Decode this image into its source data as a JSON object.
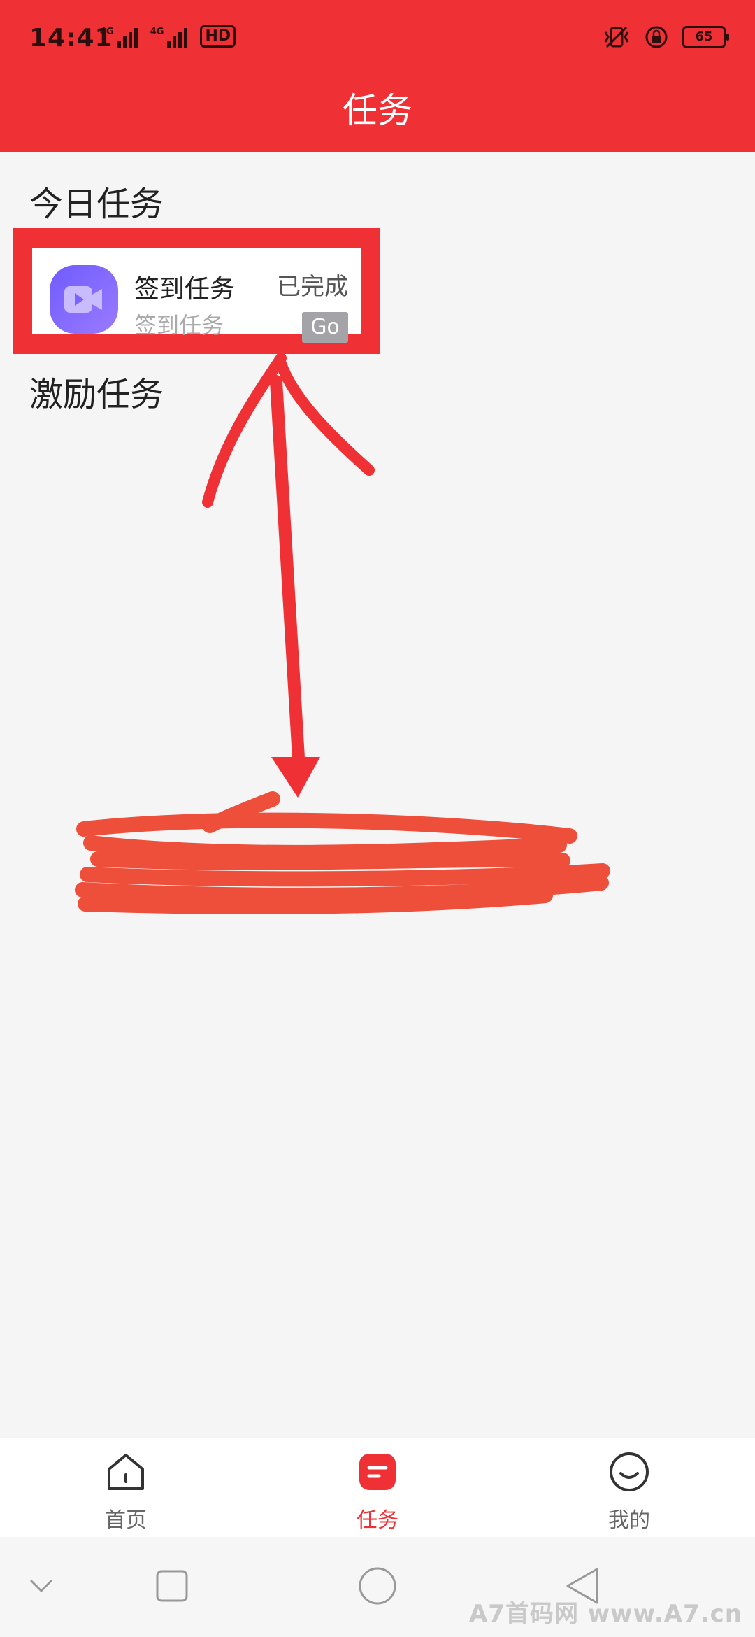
{
  "status_bar": {
    "time": "14:41",
    "signal_labels": [
      "4G",
      "4G"
    ],
    "hd_label": "HD",
    "battery": "65",
    "icons": [
      "vibrate-icon",
      "rotation-lock-icon",
      "battery-icon"
    ]
  },
  "header": {
    "title": "任务",
    "background": "#ef3136"
  },
  "sections": {
    "today_title": "今日任务",
    "incentive_title": "激励任务"
  },
  "task_card": {
    "name": "签到任务",
    "subtitle": "签到任务",
    "status": "已完成",
    "go_label": "Go",
    "icon": "video-play-icon"
  },
  "tabbar": {
    "items": [
      {
        "label": "首页",
        "icon": "home-icon",
        "active": false
      },
      {
        "label": "任务",
        "icon": "task-icon",
        "active": true
      },
      {
        "label": "我的",
        "icon": "profile-smile-icon",
        "active": false
      }
    ],
    "active_color": "#ef3136"
  },
  "system_nav": {
    "icons": [
      "chevron-down-icon",
      "recent-apps-icon",
      "home-circle-icon",
      "back-triangle-icon"
    ]
  },
  "watermark": "A7首码网 www.A7.cn"
}
